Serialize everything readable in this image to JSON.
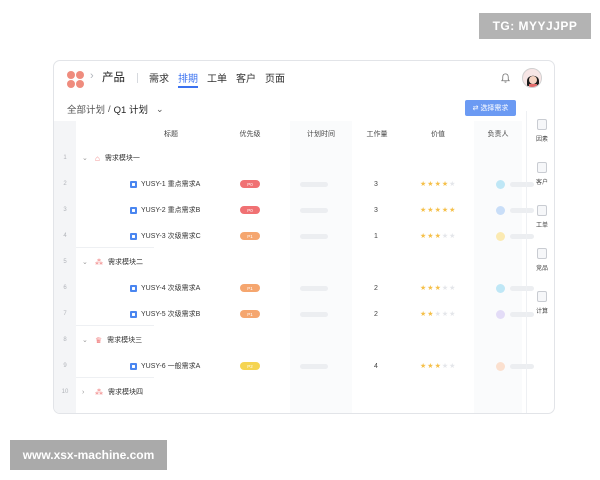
{
  "watermarks": {
    "tg": "TG: MYYJJPP",
    "site": "www.xsx-machine.com"
  },
  "header": {
    "product": "产品",
    "tabs": [
      {
        "label": "需求",
        "active": false
      },
      {
        "label": "排期",
        "active": true
      },
      {
        "label": "工单",
        "active": false
      },
      {
        "label": "客户",
        "active": false
      },
      {
        "label": "页面",
        "active": false
      }
    ]
  },
  "subbar": {
    "all_plans": "全部计划",
    "separator": "/",
    "current_plan": "Q1 计划",
    "pick_button": "选择需求"
  },
  "columns": [
    "标题",
    "优先级",
    "计划时间",
    "工作量",
    "价值",
    "负责人"
  ],
  "row_numbers": [
    "1",
    "2",
    "3",
    "4",
    "5",
    "6",
    "7",
    "8",
    "9",
    "10"
  ],
  "groups": [
    {
      "title": "需求模块一",
      "icon": "house-icon",
      "icon_color": "#f07a7a",
      "items": [
        {
          "title": "YUSY-1  重点需求A",
          "priority": "P0",
          "priority_color": "#f07173",
          "workload": "3",
          "stars": 4,
          "owner_color": "#bfe7f6"
        },
        {
          "title": "YUSY-2  重点需求B",
          "priority": "P0",
          "priority_color": "#f07173",
          "workload": "3",
          "stars": 5,
          "owner_color": "#c9def8"
        },
        {
          "title": "YUSY-3  次级需求C",
          "priority": "P1",
          "priority_color": "#f5a66f",
          "workload": "1",
          "stars": 3,
          "owner_color": "#fbeab2"
        }
      ]
    },
    {
      "title": "需求模块二",
      "icon": "cluster-icon",
      "icon_color": "#f07a7a",
      "items": [
        {
          "title": "YUSY-4  次级需求A",
          "priority": "P1",
          "priority_color": "#f5a66f",
          "workload": "2",
          "stars": 3,
          "owner_color": "#bfe7f6"
        },
        {
          "title": "YUSY-5  次级需求B",
          "priority": "P1",
          "priority_color": "#f5a66f",
          "workload": "2",
          "stars": 2,
          "owner_color": "#e3dcf7"
        }
      ]
    },
    {
      "title": "需求模块三",
      "icon": "crown-icon",
      "icon_color": "#f07a7a",
      "items": [
        {
          "title": "YUSY-6  一般需求A",
          "priority": "P2",
          "priority_color": "#f5d451",
          "workload": "4",
          "stars": 3,
          "owner_color": "#fbe0cf"
        }
      ]
    },
    {
      "title": "需求模块四",
      "icon": "cluster-icon",
      "icon_color": "#f07a7a",
      "items": []
    }
  ],
  "rightbar": [
    "因素",
    "客户",
    "工单",
    "竞品",
    "计算"
  ],
  "colors": {
    "accent": "#3b72f0",
    "button": "#6b9af3",
    "star_on": "#f5c04a",
    "star_off": "#e4e6ea"
  }
}
